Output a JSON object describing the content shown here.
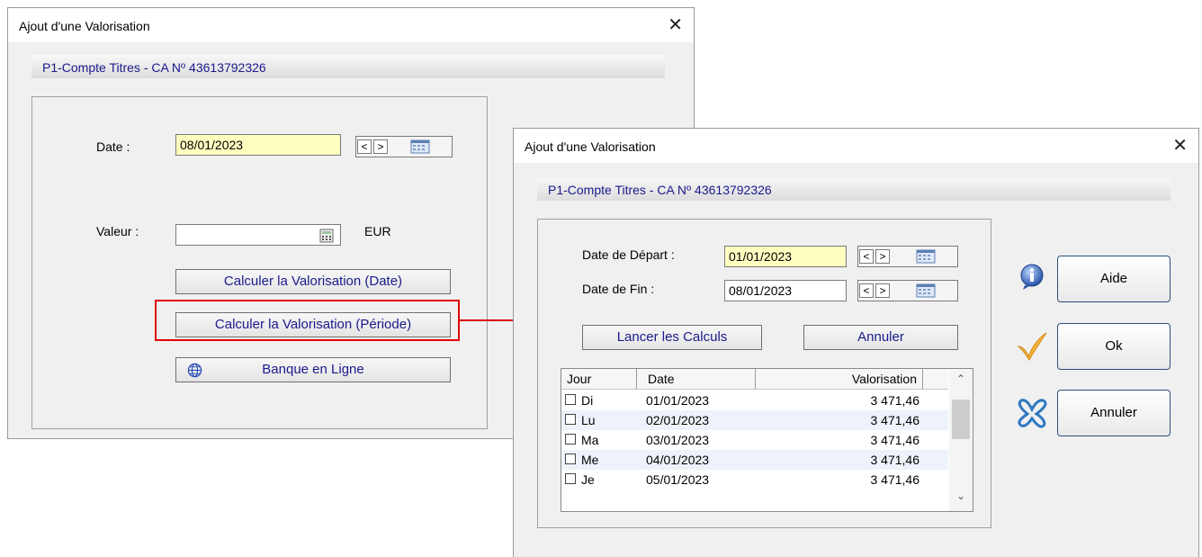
{
  "dialog1": {
    "title": "Ajout d'une Valorisation",
    "close_glyph": "✕",
    "account": "P1-Compte Titres - CA Nº 43613792326",
    "date_label": "Date :",
    "date_value": "08/01/2023",
    "nav_prev": "<",
    "nav_next": ">",
    "value_label": "Valeur :",
    "value_value": "",
    "currency": "EUR",
    "btn_calc_date": "Calculer la Valorisation (Date)",
    "btn_calc_period": "Calculer la Valorisation (Période)",
    "btn_bank": "Banque en Ligne"
  },
  "dialog2": {
    "title": "Ajout d'une Valorisation",
    "close_glyph": "✕",
    "account": "P1-Compte Titres - CA Nº 43613792326",
    "start_label": "Date de Départ :",
    "start_value": "01/01/2023",
    "end_label": "Date de Fin :",
    "end_value": "08/01/2023",
    "nav_prev": "<",
    "nav_next": ">",
    "btn_run": "Lancer les Calculs",
    "btn_cancel_inner": "Annuler",
    "table": {
      "headers": [
        "Jour",
        "Date",
        "Valorisation"
      ],
      "rows": [
        {
          "jour": "Di",
          "date": "01/01/2023",
          "val": "3 471,46"
        },
        {
          "jour": "Lu",
          "date": "02/01/2023",
          "val": "3 471,46"
        },
        {
          "jour": "Ma",
          "date": "03/01/2023",
          "val": "3 471,46"
        },
        {
          "jour": "Me",
          "date": "04/01/2023",
          "val": "3 471,46"
        },
        {
          "jour": "Je",
          "date": "05/01/2023",
          "val": "3 471,46"
        }
      ]
    },
    "btn_help": "Aide",
    "btn_ok": "Ok",
    "btn_cancel": "Annuler"
  },
  "icons": {
    "calendar": "calendar-icon",
    "calculator": "calculator-icon",
    "globe": "globe-icon",
    "info": "info-icon",
    "check": "checkmark-icon",
    "cancel": "cancel-x-icon"
  },
  "colors": {
    "highlight_field": "#ffffc0",
    "accent_text": "#1a1a8c",
    "callout": "#e00000"
  }
}
